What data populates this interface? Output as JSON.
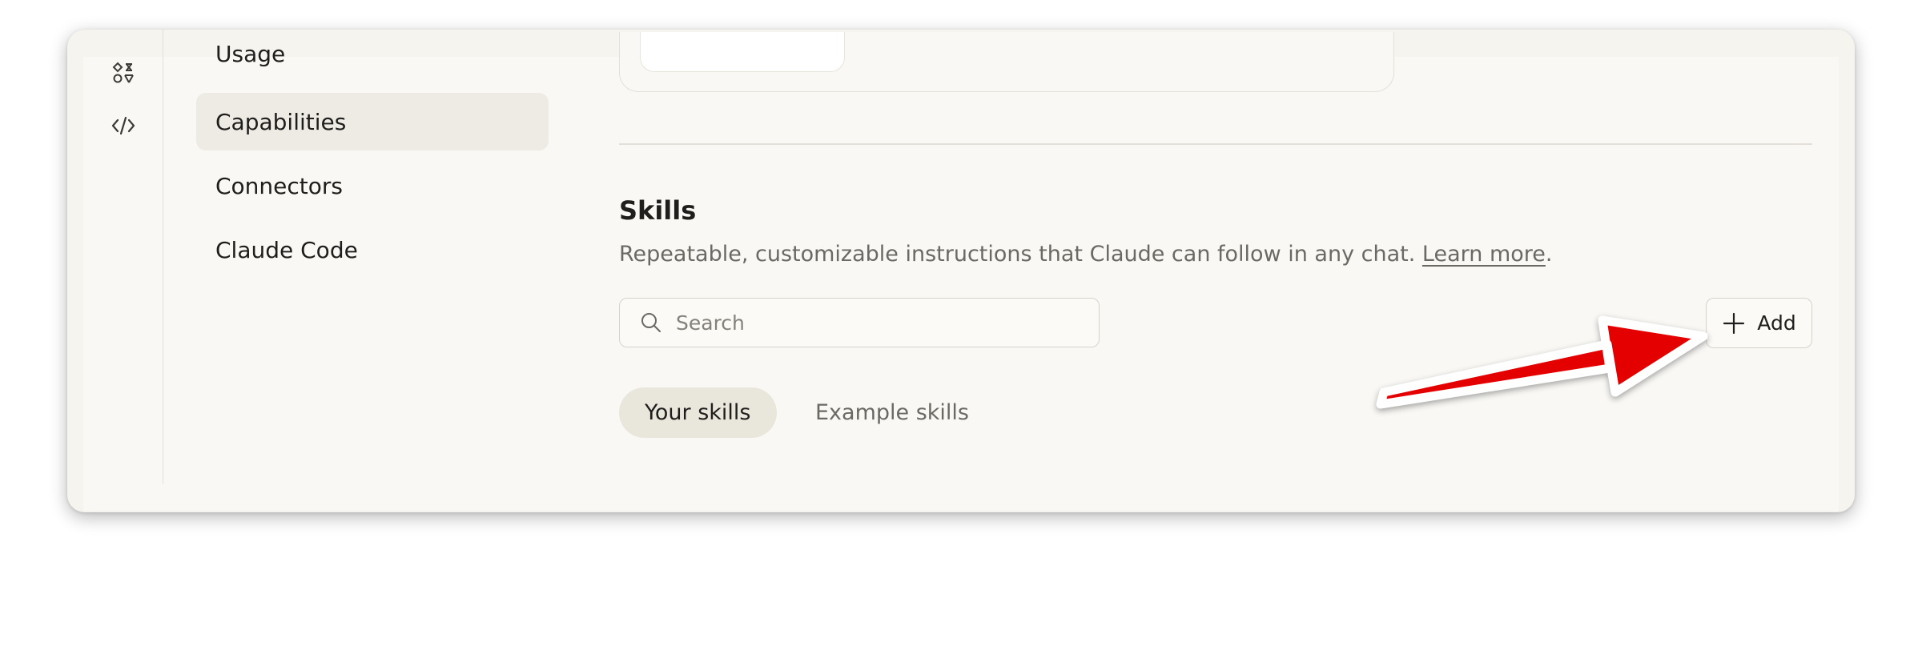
{
  "sidebar": {
    "nav_items": [
      {
        "label": "Usage"
      },
      {
        "label": "Capabilities"
      },
      {
        "label": "Connectors"
      },
      {
        "label": "Claude Code"
      }
    ]
  },
  "skills": {
    "title": "Skills",
    "description": "Repeatable, customizable instructions that Claude can follow in any chat.",
    "learn_more": "Learn more",
    "description_end": ".",
    "search": {
      "placeholder": "Search",
      "value": ""
    },
    "add_label": "Add",
    "tabs": [
      {
        "label": "Your skills",
        "active": true
      },
      {
        "label": "Example skills",
        "active": false
      }
    ]
  },
  "colors": {
    "annotation_arrow": "#e50000",
    "active_nav_bg": "#edebe4",
    "active_tab_bg": "#e9e6dc"
  },
  "icons": [
    "apps-icon",
    "code-icon",
    "search-icon",
    "plus-icon"
  ]
}
